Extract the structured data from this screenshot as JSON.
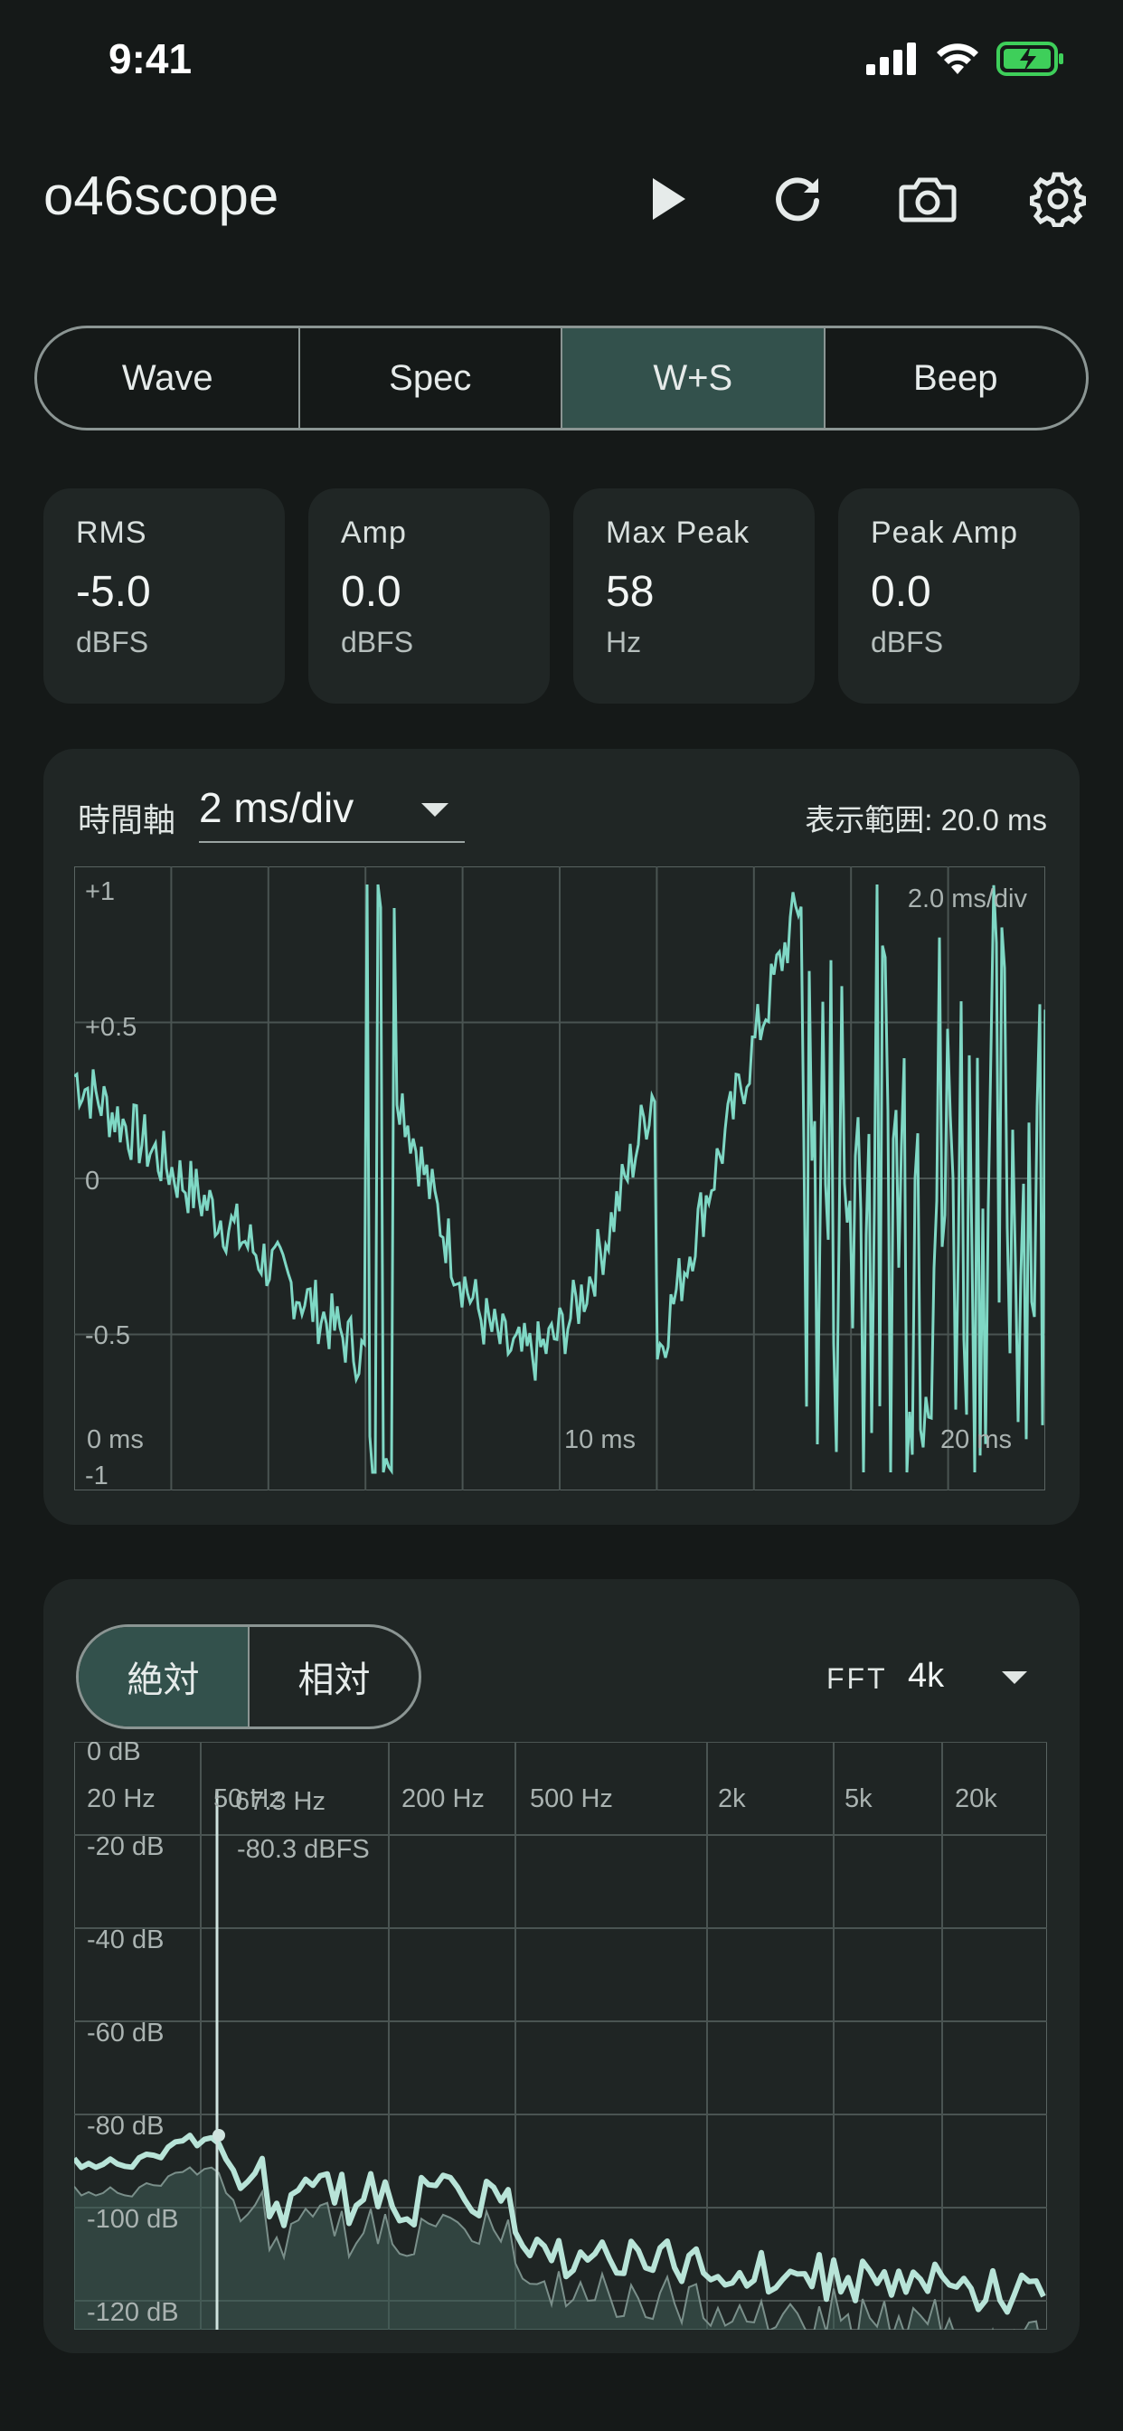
{
  "status_bar": {
    "time": "9:41"
  },
  "app": {
    "title": "o46scope"
  },
  "tabs": [
    {
      "label": "Wave",
      "active": false
    },
    {
      "label": "Spec",
      "active": false
    },
    {
      "label": "W+S",
      "active": true
    },
    {
      "label": "Beep",
      "active": false
    }
  ],
  "stats": [
    {
      "label": "RMS",
      "value": "-5.0",
      "unit": "dBFS"
    },
    {
      "label": "Amp",
      "value": "0.0",
      "unit": "dBFS"
    },
    {
      "label": "Max Peak",
      "value": "58",
      "unit": "Hz"
    },
    {
      "label": "Peak Amp",
      "value": "0.0",
      "unit": "dBFS"
    }
  ],
  "wave": {
    "time_axis_label": "時間軸",
    "time_div": "2 ms/div",
    "range_label": "表示範囲: 20.0 ms",
    "div_label": "2.0 ms/div",
    "y_labels": [
      "+1",
      "+0.5",
      "0",
      "-0.5",
      "-1"
    ],
    "x_labels": [
      "0 ms",
      "10 ms",
      "20 ms"
    ],
    "color": "#7fd8c5"
  },
  "spectrum": {
    "modes": [
      "絶対",
      "相対"
    ],
    "active_mode": "絶対",
    "fft_label": "FFT",
    "fft_value": "4k",
    "db_labels": [
      "0 dB",
      "-20 dB",
      "-40 dB",
      "-60 dB",
      "-80 dB",
      "-100 dB",
      "-120 dB"
    ],
    "freq_labels": [
      "20 Hz",
      "50 Hz",
      "200 Hz",
      "500 Hz",
      "2k",
      "5k",
      "20k"
    ],
    "cursor_freq": "67.3 Hz",
    "cursor_level": "-80.3 dBFS",
    "color": "#b8e4d8"
  }
}
